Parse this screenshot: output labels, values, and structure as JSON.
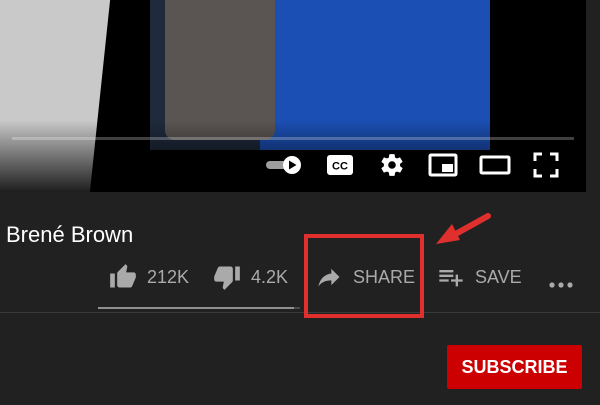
{
  "video": {
    "controls": [
      {
        "name": "autoplay-toggle"
      },
      {
        "name": "captions-button"
      },
      {
        "name": "settings-button"
      },
      {
        "name": "miniplayer-button"
      },
      {
        "name": "theater-mode-button"
      },
      {
        "name": "fullscreen-button"
      }
    ]
  },
  "title": "Brené Brown",
  "actions": {
    "like": {
      "count": "212K",
      "icon": "thumbs-up-icon"
    },
    "dislike": {
      "count": "4.2K",
      "icon": "thumbs-down-icon"
    },
    "share": {
      "label": "SHARE",
      "icon": "share-arrow-icon"
    },
    "save": {
      "label": "SAVE",
      "icon": "playlist-add-icon"
    },
    "more": {
      "icon": "more-horizontal-icon"
    }
  },
  "subscribe_label": "SUBSCRIBE",
  "colors": {
    "background": "#212121",
    "text_secondary": "#aaaaaa",
    "subscribe_bg": "#cc0000",
    "highlight": "#e0302e"
  }
}
